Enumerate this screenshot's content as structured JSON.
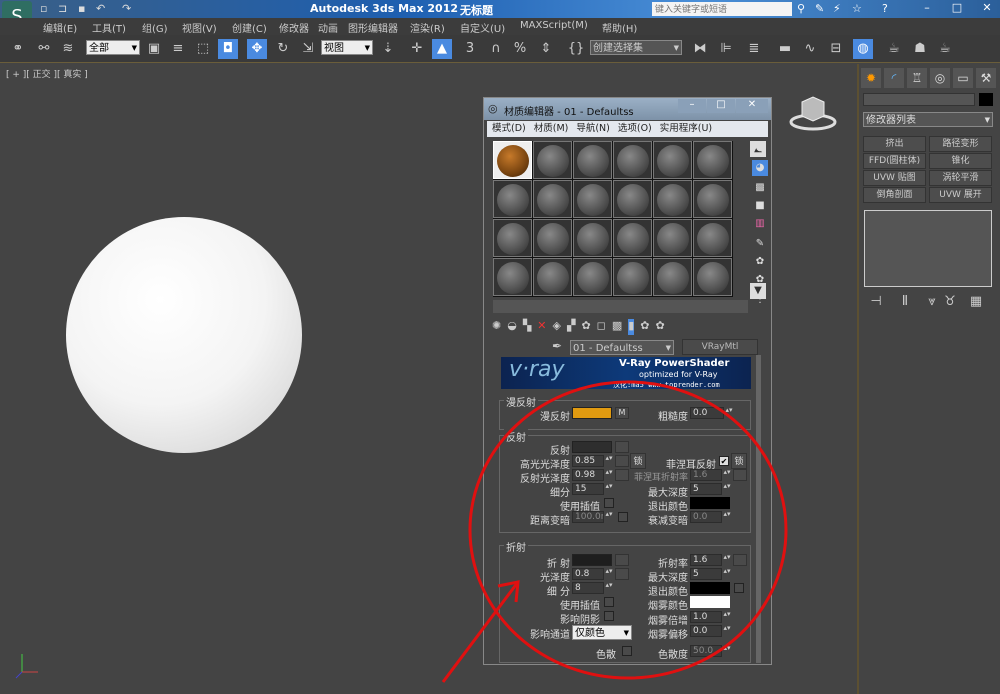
{
  "app": {
    "title": "Autodesk 3ds Max  2012",
    "doc_title": "无标题",
    "search_placeholder": "键入关键字或短语"
  },
  "menu": [
    "编辑(E)",
    "工具(T)",
    "组(G)",
    "视图(V)",
    "创建(C)",
    "修改器",
    "动画",
    "图形编辑器",
    "渲染(R)",
    "自定义(U)",
    "MAXScript(M)",
    "帮助(H)"
  ],
  "toolbar": {
    "selection_filter": "全部",
    "ref_coord": "视图",
    "named_selection": "创建选择集",
    "snap_label": "3"
  },
  "viewport": {
    "label": "[ + ][ 正交 ][ 真实 ]"
  },
  "command_panel": {
    "modifier_list": "修改器列表",
    "buttons": [
      "挤出",
      "路径变形",
      "FFD(圆柱体)",
      "锥化",
      "UVW 贴图",
      "涡轮平滑",
      "倒角剖面",
      "UVW 展开"
    ]
  },
  "material_editor": {
    "title": "材质编辑器 - 01 - Defaultss",
    "menu": [
      "模式(D)",
      "材质(M)",
      "导航(N)",
      "选项(O)",
      "实用程序(U)"
    ],
    "material_name": "01 - Defaultss",
    "material_type": "VRayMtl",
    "banner": {
      "logo": "v·ray",
      "title": "V-Ray PowerShader",
      "subtitle": "optimized for V-Ray",
      "credit": "汉化:ma5  www.toprender.com"
    },
    "diffuse": {
      "group": "漫反射",
      "diffuse_label": "漫反射",
      "map_btn": "M",
      "roughness_label": "粗糙度",
      "roughness": "0.0",
      "color": "#e09a10"
    },
    "reflection": {
      "group": "反射",
      "reflect_label": "反射",
      "hilight_label": "高光光泽度",
      "hilight": "0.85",
      "lock": "锁",
      "refl_gloss_label": "反射光泽度",
      "refl_gloss": "0.98",
      "subdivs_label": "细分",
      "subdivs": "15",
      "interp_label": "使用插值",
      "dim_label": "距离变暗",
      "dim": "100.0m",
      "fresnel_label": "菲涅耳反射",
      "fresnel_checked": true,
      "fresnel_lock": "锁",
      "fresnel_ior_label": "菲涅耳折射率",
      "fresnel_ior": "1.6",
      "max_depth_label": "最大深度",
      "max_depth": "5",
      "exit_label": "退出颜色",
      "dim_falloff_label": "衰减变暗",
      "dim_falloff": "0.0"
    },
    "refraction": {
      "group": "折射",
      "refract_label": "折 射",
      "gloss_label": "光泽度",
      "gloss": "0.8",
      "subdivs_label": "细 分",
      "subdivs": "8",
      "interp_label": "使用插值",
      "shadows_label": "影响阴影",
      "channels_label": "影响通道",
      "channels": "仅颜色",
      "dispersion_label": "色散",
      "ior_label": "折射率",
      "ior": "1.6",
      "max_depth_label": "最大深度",
      "max_depth": "5",
      "exit_label": "退出颜色",
      "fog_color_label": "烟雾颜色",
      "fog_mult_label": "烟雾倍增",
      "fog_mult": "1.0",
      "fog_bias_label": "烟雾偏移",
      "fog_bias": "0.0",
      "abbe_label": "色散度",
      "abbe": "50.0"
    }
  },
  "annotation_color": "#e01010"
}
